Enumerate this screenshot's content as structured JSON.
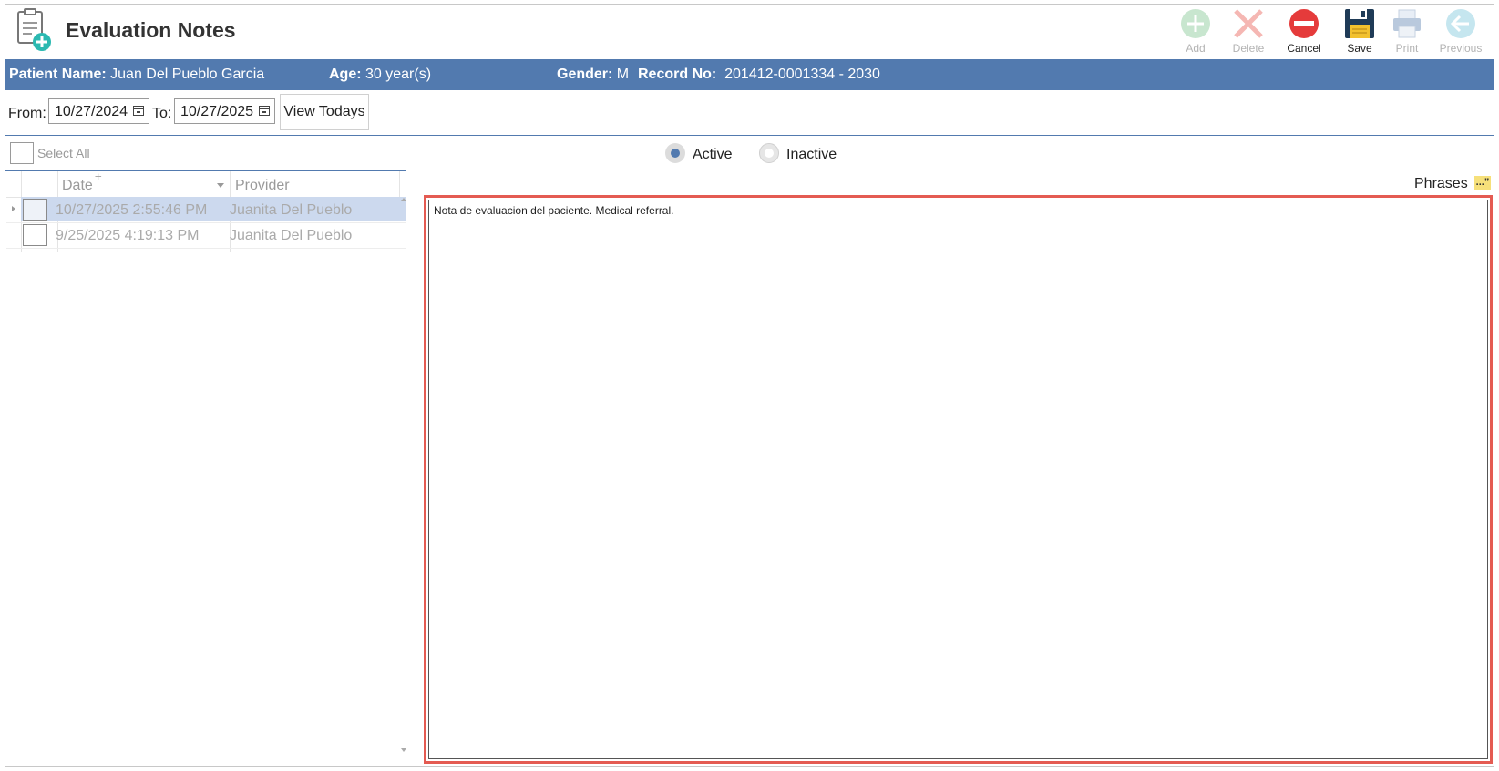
{
  "header": {
    "title": "Evaluation Notes",
    "app_icon": "clipboard-add-icon"
  },
  "toolbar": {
    "add_label": "Add",
    "delete_label": "Delete",
    "cancel_label": "Cancel",
    "save_label": "Save",
    "print_label": "Print",
    "previous_label": "Previous"
  },
  "patient": {
    "name_label": "Patient Name:",
    "name_value": "Juan Del Pueblo Garcia",
    "age_label": "Age:",
    "age_value": "30 year(s)",
    "gender_label": "Gender:",
    "gender_value": "M",
    "record_label": "Record No:",
    "record_value": "201412-0001334 - 2030"
  },
  "filter": {
    "from_label": "From:",
    "from_value": "10/27/2024",
    "to_label": "To:",
    "to_value": "10/27/2025",
    "view_todays_label": "View Todays"
  },
  "status": {
    "select_all_label": "Select All",
    "active_label": "Active",
    "inactive_label": "Inactive",
    "selected": "Active"
  },
  "grid": {
    "columns": [
      "Date",
      "Provider"
    ],
    "rows": [
      {
        "date": "10/27/2025 2:55:46 PM",
        "provider": "Juanita Del Pueblo",
        "selected": true
      },
      {
        "date": "9/25/2025 4:19:13 PM",
        "provider": "Juanita Del Pueblo",
        "selected": false
      }
    ]
  },
  "notes": {
    "phrases_label": "Phrases",
    "phrases_icon_text": "...”",
    "text": "Nota de evaluacion del paciente. Medical referral."
  },
  "colors": {
    "accent": "#527aaf",
    "highlight_border": "#e45b52",
    "selected_row": "#ccd9ee"
  }
}
